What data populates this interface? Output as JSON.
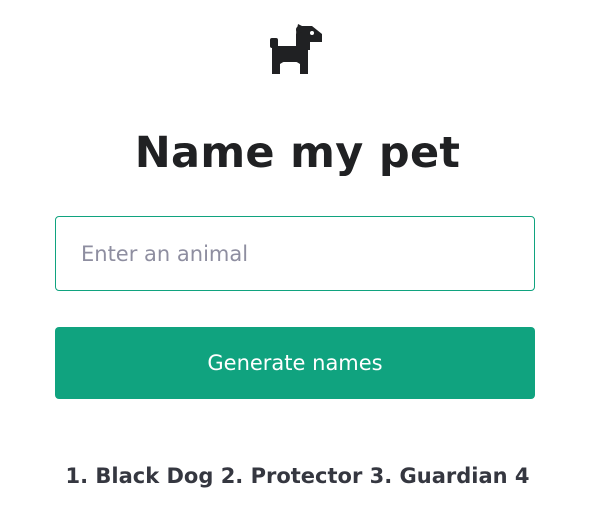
{
  "header": {
    "logo_icon": "dog-icon",
    "title": "Name my pet"
  },
  "form": {
    "animal_input": {
      "value": "",
      "placeholder": "Enter an animal"
    },
    "submit_label": "Generate names"
  },
  "result": {
    "text": "1. Black Dog 2. Protector 3. Guardian 4"
  },
  "colors": {
    "accent": "#10a37f",
    "title": "#202123",
    "placeholder": "#8e8ea0",
    "result": "#353740"
  }
}
